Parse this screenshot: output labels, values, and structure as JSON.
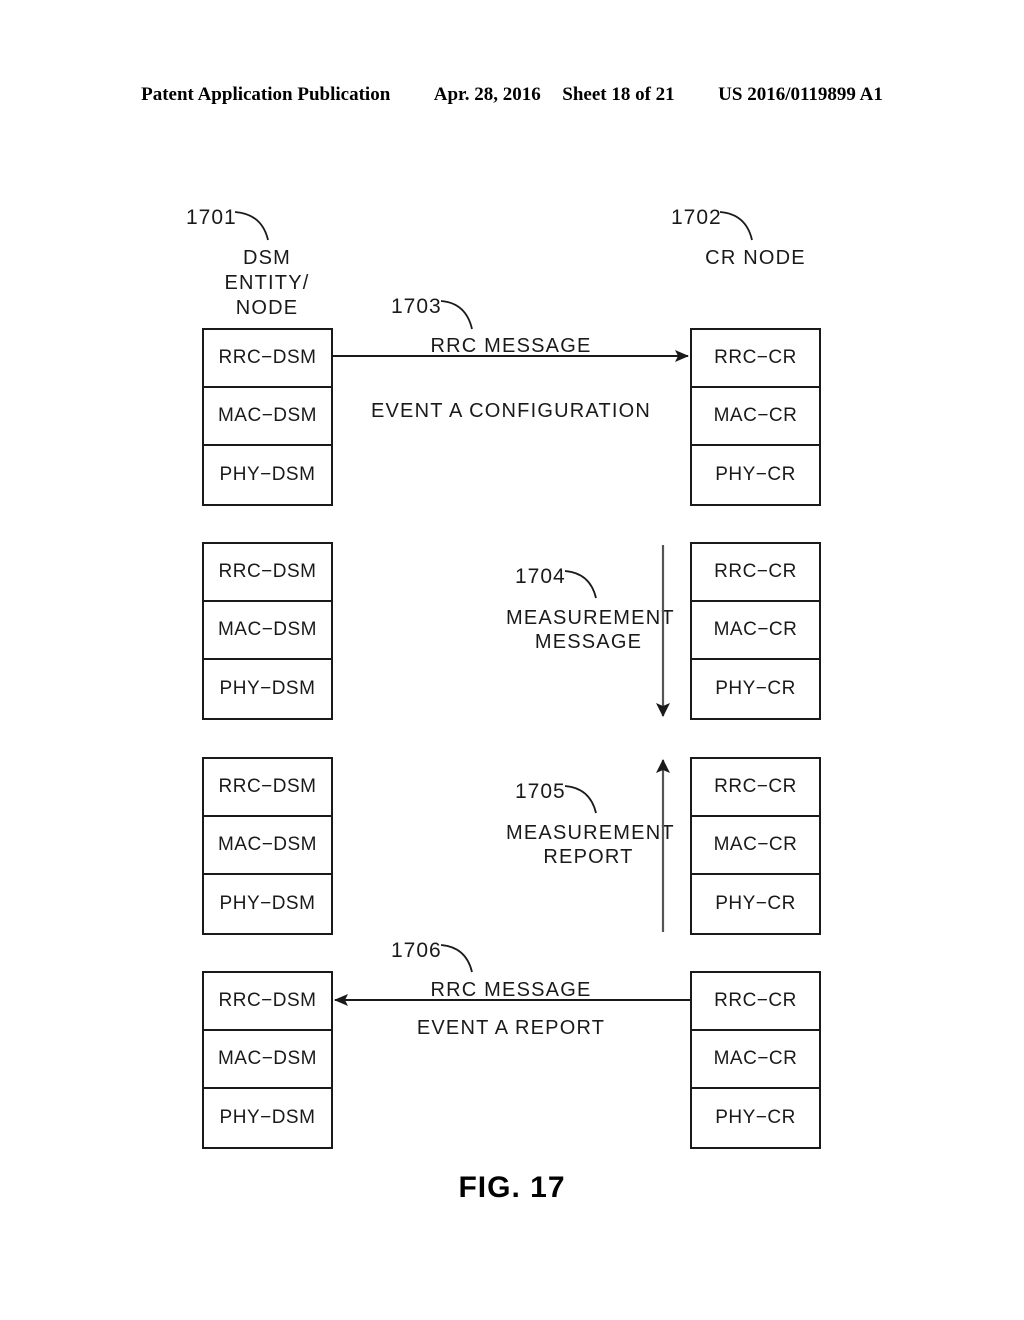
{
  "header": {
    "publication": "Patent Application Publication",
    "date": "Apr. 28, 2016",
    "sheet": "Sheet 18 of 21",
    "patent_number": "US 2016/0119899 A1"
  },
  "figure": {
    "caption": "FIG. 17",
    "left_node": {
      "ref": "1701",
      "title_line1": "DSM",
      "title_line2": "ENTITY/",
      "title_line3": "NODE"
    },
    "right_node": {
      "ref": "1702",
      "title": "CR NODE"
    },
    "stacks": {
      "left_layers": [
        "RRC−DSM",
        "MAC−DSM",
        "PHY−DSM"
      ],
      "right_layers": [
        "RRC−CR",
        "MAC−CR",
        "PHY−CR"
      ]
    },
    "messages": [
      {
        "ref": "1703",
        "line1": "RRC  MESSAGE",
        "line2": "EVENT  A  CONFIGURATION",
        "direction": "left-to-right"
      },
      {
        "ref": "1704",
        "line1": "MEASUREMENT",
        "line2": "MESSAGE",
        "direction": "top-to-bottom"
      },
      {
        "ref": "1705",
        "line1": "MEASUREMENT",
        "line2": "REPORT",
        "direction": "bottom-to-top"
      },
      {
        "ref": "1706",
        "line1": "RRC  MESSAGE",
        "line2": "EVENT  A  REPORT",
        "direction": "right-to-left"
      }
    ]
  },
  "colors": {
    "ink": "#1a1a1a",
    "paper": "#ffffff"
  }
}
